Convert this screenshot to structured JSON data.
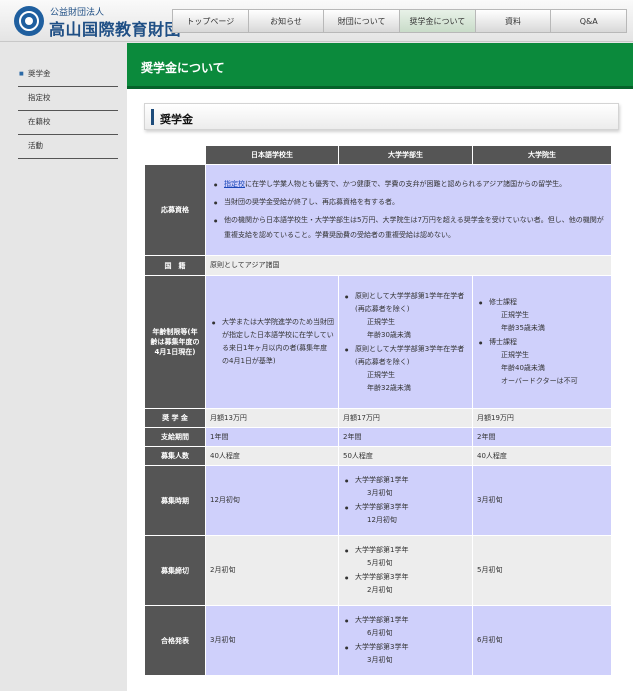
{
  "header": {
    "logo_subtitle": "公益財団法人",
    "logo_title": "高山国際教育財団",
    "nav": [
      "トップページ",
      "お知らせ",
      "財団について",
      "奨学金について",
      "資料",
      "Q&A"
    ]
  },
  "sidebar": {
    "items": [
      "奨学金",
      "指定校",
      "在籍校",
      "活動"
    ]
  },
  "page": {
    "title": "奨学金について",
    "section": "奨学金"
  },
  "table": {
    "columns": [
      "日本語学校生",
      "大学学部生",
      "大学院生"
    ],
    "rows": {
      "eligibility": {
        "label": "応募資格",
        "line1_link": "指定校",
        "line1_rest": "に在学し学業人物とも優秀で、かつ健康で、学費の支弁が困難と認められるアジア諸国からの留学生。",
        "line2": "当財団の奨学金受給が終了し、再応募資格を有する者。",
        "line3": "他の機関から日本語学校生・大学学部生は5万円、大学院生は7万円を超える奨学金を受けていない者。但し、他の機関が重複支給を認めていること。学費奨励費の受給者の重複受給は認めない。"
      },
      "nationality": {
        "label": "国　籍",
        "value": "原則としてアジア諸国"
      },
      "age": {
        "label": "年齢制限等(年齢は募集年度の4月1日現在)",
        "jp": "大学または大学院進学のため当財団が指定した日本語学校に在学している来日1年ヶ月以内の者(募集年度の4月1日が基準)",
        "ug": [
          {
            "main": "原則として大学学部第1学年在学者(再応募者を除く)",
            "subs": [
              "正規学生",
              "年齢30歳未満"
            ]
          },
          {
            "main": "原則として大学学部第3学年在学者(再応募者を除く)",
            "subs": [
              "正規学生",
              "年齢32歳未満"
            ]
          }
        ],
        "gr": [
          {
            "main": "修士課程",
            "subs": [
              "正規学生",
              "年齢35歳未満"
            ]
          },
          {
            "main": "博士課程",
            "subs": [
              "正規学生",
              "年齢40歳未満",
              "オーバードクターは不可"
            ]
          }
        ]
      },
      "amount": {
        "label": "奨 学 金",
        "values": [
          "月額13万円",
          "月額17万円",
          "月額19万円"
        ]
      },
      "period": {
        "label": "支給期間",
        "values": [
          "1年間",
          "2年間",
          "2年間"
        ]
      },
      "recruits": {
        "label": "募集人数",
        "values": [
          "40人程度",
          "50人程度",
          "40人程度"
        ]
      },
      "recruit_time": {
        "label": "募集時期",
        "jp": "12月初旬",
        "ug": [
          {
            "main": "大学学部第1学年",
            "sub": "3月初旬"
          },
          {
            "main": "大学学部第3学年",
            "sub": "12月初旬"
          }
        ],
        "gr": "3月初旬"
      },
      "deadline": {
        "label": "募集締切",
        "jp": "2月初旬",
        "ug": [
          {
            "main": "大学学部第1学年",
            "sub": "5月初旬"
          },
          {
            "main": "大学学部第3学年",
            "sub": "2月初旬"
          }
        ],
        "gr": "5月初旬"
      },
      "announce": {
        "label": "合格発表",
        "jp": "3月初旬",
        "ug": [
          {
            "main": "大学学部第1学年",
            "sub": "6月初旬"
          },
          {
            "main": "大学学部第3学年",
            "sub": "3月初旬"
          }
        ],
        "gr": "6月初旬"
      }
    }
  },
  "colors": {
    "banner": "#0b8a3c",
    "header_cell": "#555555",
    "cell_lavender": "#cfd0fb",
    "cell_gray": "#ededed",
    "link": "#1a46b8"
  }
}
